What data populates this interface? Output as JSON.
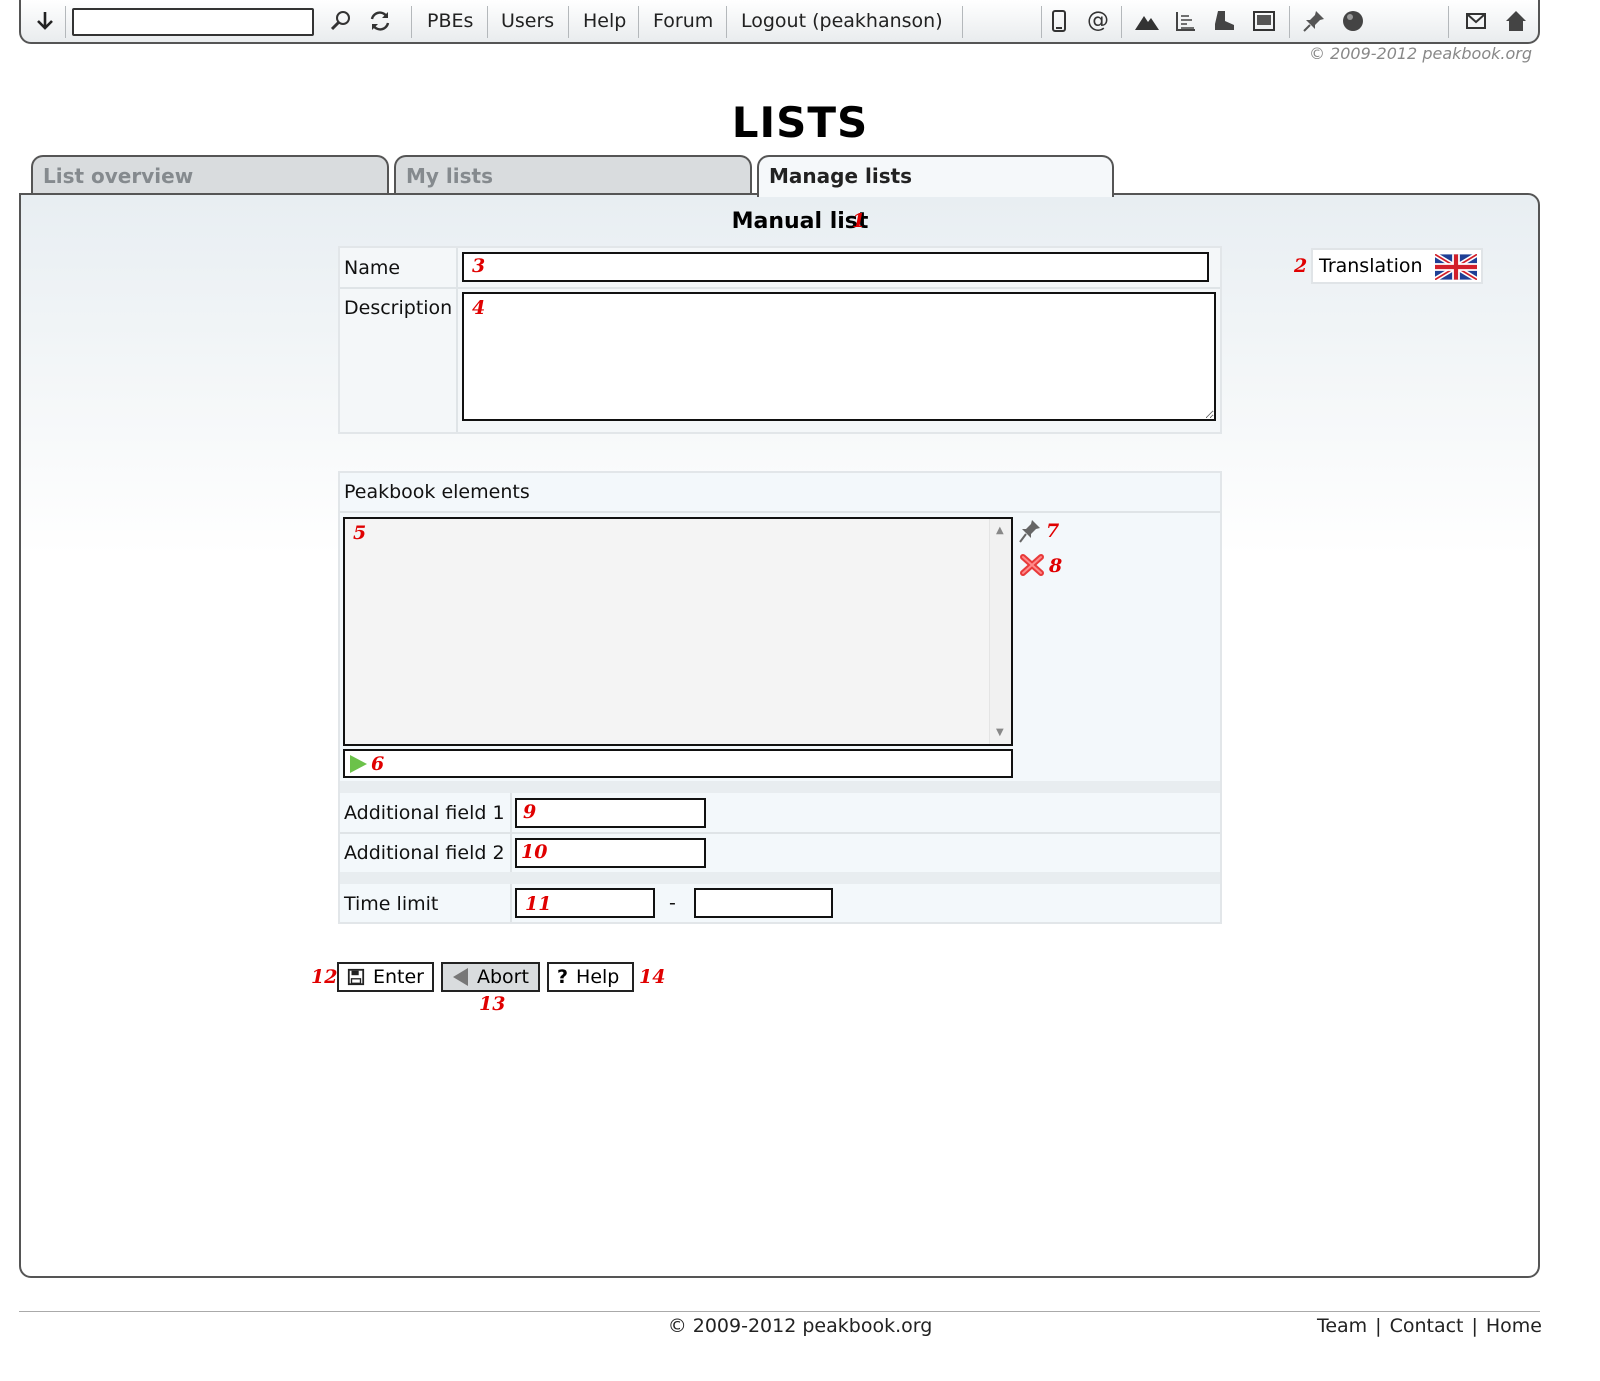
{
  "toolbar": {
    "search_value": "",
    "links": [
      "PBEs",
      "Users",
      "Help",
      "Forum",
      "Logout (peakhanson)"
    ],
    "icons": [
      "download-icon",
      "search-icon",
      "refresh-icon",
      "phone-icon",
      "at-icon",
      "mountain-icon",
      "list-icon",
      "boot-icon",
      "photo-icon",
      "pin-icon",
      "globe-icon",
      "mail-icon",
      "home-icon"
    ]
  },
  "copyright_top": "© 2009-2012 peakbook.org",
  "page_title": "LISTS",
  "tabs": [
    "List overview",
    "My lists",
    "Manage lists"
  ],
  "form": {
    "title": "Manual list",
    "name_label": "Name",
    "description_label": "Description",
    "name_value": "",
    "description_value": "",
    "translation_label": "Translation",
    "elements_label": "Peakbook elements",
    "additional_field_1_label": "Additional field 1",
    "additional_field_2_label": "Additional field 2",
    "time_limit_label": "Time limit",
    "time_limit_sep": "-",
    "additional_field_1_value": "",
    "additional_field_2_value": "",
    "time_limit_from": "",
    "time_limit_to": ""
  },
  "buttons": {
    "enter": "Enter",
    "abort": "Abort",
    "help": "Help"
  },
  "annotations": [
    "1",
    "2",
    "3",
    "4",
    "5",
    "6",
    "7",
    "8",
    "9",
    "10",
    "11",
    "12",
    "13",
    "14"
  ],
  "footer": {
    "copyright": "© 2009-2012 peakbook.org",
    "links": [
      "Team",
      "Contact",
      "Home"
    ],
    "separator": "|"
  },
  "colors": {
    "annotation": "#e00000",
    "panel_top": "#e8eef2",
    "tab_inactive": "#d9dcde"
  }
}
